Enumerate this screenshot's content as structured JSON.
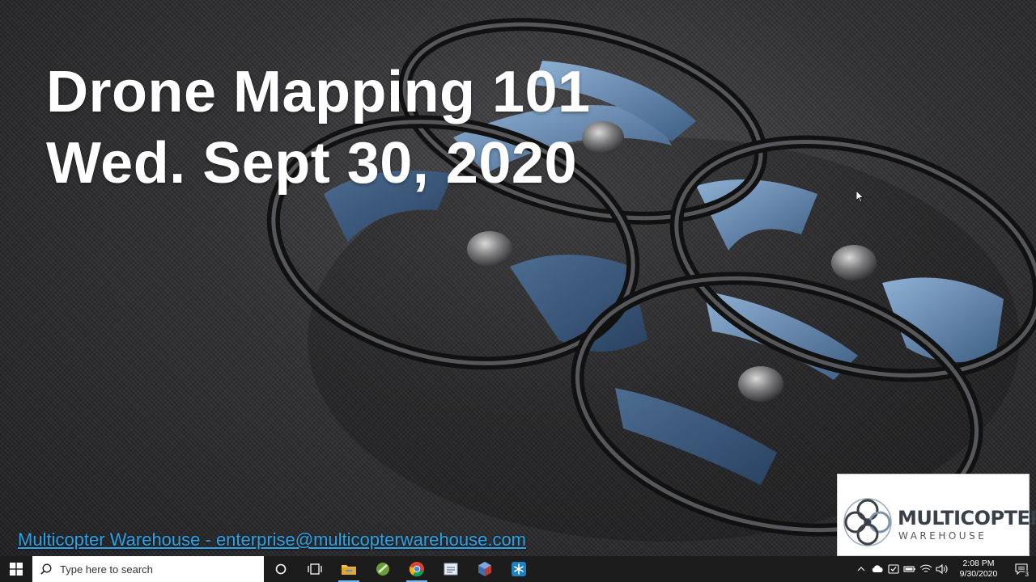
{
  "slide": {
    "title_line1": "Drone Mapping 101",
    "title_line2": "Wed. Sept 30, 2020",
    "contact_link": "Multicopter Warehouse - enterprise@multicopterwarehouse.com",
    "logo": {
      "name": "MULTICOPTER",
      "sub": "WAREHOUSE"
    }
  },
  "taskbar": {
    "search_placeholder": "Type here to search",
    "pinned_apps": [
      "task-view",
      "file-explorer",
      "app-green",
      "chrome",
      "notepad",
      "app-cube",
      "app-snowflake"
    ],
    "clock_time": "2:08 PM",
    "clock_date": "9/30/2020",
    "notification_count": "3"
  },
  "colors": {
    "link": "#2aa4e8",
    "taskbar": "#1c1c1c",
    "blade_blue": "#5b7fa6",
    "frame_dark": "#2b2b2d"
  }
}
